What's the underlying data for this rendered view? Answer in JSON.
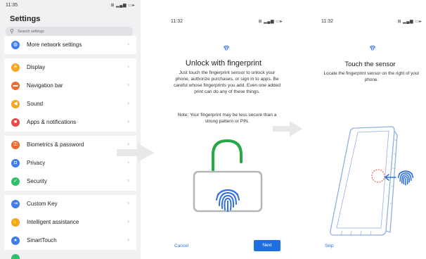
{
  "settings": {
    "status_time": "11:35",
    "title": "Settings",
    "search_placeholder": "Search settings",
    "groups": [
      [
        {
          "label": "More network settings",
          "icon": "globe-icon",
          "color": "#3f7ee8"
        }
      ],
      [
        {
          "label": "Display",
          "icon": "sun-icon",
          "color": "#f5a623"
        },
        {
          "label": "Navigation bar",
          "icon": "navigation-icon",
          "color": "#ef6a2e"
        },
        {
          "label": "Sound",
          "icon": "speaker-icon",
          "color": "#f5a623"
        },
        {
          "label": "Apps & notifications",
          "icon": "apps-icon",
          "color": "#ec4848"
        }
      ],
      [
        {
          "label": "Biometrics & password",
          "icon": "key-icon",
          "color": "#ef6a2e"
        },
        {
          "label": "Privacy",
          "icon": "lock-icon",
          "color": "#3f7ee8"
        },
        {
          "label": "Security",
          "icon": "shield-icon",
          "color": "#2ebf6b"
        }
      ],
      [
        {
          "label": "Custom Key",
          "icon": "custom-key-icon",
          "color": "#3f7ee8"
        },
        {
          "label": "Intelligent assistance",
          "icon": "hand-icon",
          "color": "#f5a623"
        },
        {
          "label": "SmartTouch",
          "icon": "touch-icon",
          "color": "#3f7ee8"
        }
      ]
    ]
  },
  "unlock": {
    "status_time": "11:32",
    "title": "Unlock with fingerprint",
    "body": "Just touch the fingerprint sensor to unlock your phone, authorize purchases, or sign in to apps. Be careful whose fingerprints you add. Even one added print can do any of these things.",
    "note": "Note: Your fingerprint may be less secure than a strong pattern or PIN.",
    "cancel_label": "Cancel",
    "next_label": "Next"
  },
  "sensor": {
    "status_time": "11:32",
    "title": "Touch the sensor",
    "body": "Locate the fingerprint sensor on the right of your phone.",
    "skip_label": "Skip"
  },
  "colors": {
    "accent": "#1f6fe0",
    "fingerprint": "#2f6fe3",
    "shackle": "#27a745",
    "lock_body": "#b5b5b5",
    "sensor_marker": "#e04a4a"
  }
}
